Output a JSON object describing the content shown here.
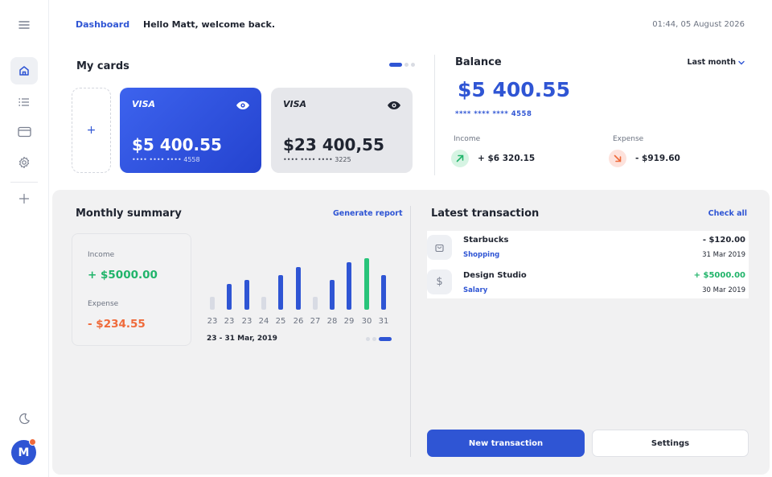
{
  "header": {
    "breadcrumb": "Dashboard",
    "greeting": "Hello Matt, welcome back.",
    "datetime": "01:44, 05 August 2026"
  },
  "sidebar": {
    "avatar_initial": "M",
    "items": [
      "menu-icon",
      "home-icon",
      "list-icon",
      "card-icon",
      "settings-icon",
      "plus-icon",
      "moon-icon"
    ]
  },
  "cards": {
    "title": "My cards",
    "add_label": "+",
    "items": [
      {
        "brand": "VISA",
        "amount": "$5 400.55",
        "number": "•••• •••• •••• 4558"
      },
      {
        "brand": "VISA",
        "amount": "$23 400,55",
        "number": "•••• •••• •••• 3225"
      }
    ]
  },
  "balance": {
    "title": "Balance",
    "range": "Last month",
    "amount": "$5 400.55",
    "card_number": "**** **** **** 4558",
    "income_label": "Income",
    "income_value": "+ $6 320.15",
    "expense_label": "Expense",
    "expense_value": "- $919.60"
  },
  "summary": {
    "title": "Monthly summary",
    "link": "Generate report",
    "income_label": "Income",
    "income_value": "+ $5000.00",
    "expense_label": "Expense",
    "expense_value": "- $234.55",
    "range": "23 - 31 Mar, 2019"
  },
  "chart_data": {
    "type": "bar",
    "categories": [
      "23",
      "23",
      "23",
      "24",
      "25",
      "26",
      "27",
      "28",
      "29",
      "30",
      "31"
    ],
    "values": [
      3,
      6,
      7,
      3,
      8,
      10,
      3,
      7,
      11,
      12,
      8
    ],
    "highlight_index": 9,
    "colors": {
      "active": "#2f55d4",
      "inactive": "#d8dbe4",
      "highlight": "#28c47a"
    },
    "inactive_indices": [
      0,
      3,
      6
    ],
    "grid": false
  },
  "transactions": {
    "title": "Latest transaction",
    "link": "Check all",
    "items": [
      {
        "icon": "bag-icon",
        "name": "Starbucks",
        "category": "Shopping",
        "amount": "- $120.00",
        "date": "31 Mar 2019",
        "type": "debit"
      },
      {
        "icon": "dollar-icon",
        "name": "Design Studio",
        "category": "Salary",
        "amount": "+ $5000.00",
        "date": "30 Mar 2019",
        "type": "credit"
      }
    ]
  },
  "actions": {
    "primary": "New transaction",
    "secondary": "Settings"
  },
  "colors": {
    "accent": "#2f55d4",
    "positive": "#21b46a",
    "negative": "#ef6a3a"
  }
}
